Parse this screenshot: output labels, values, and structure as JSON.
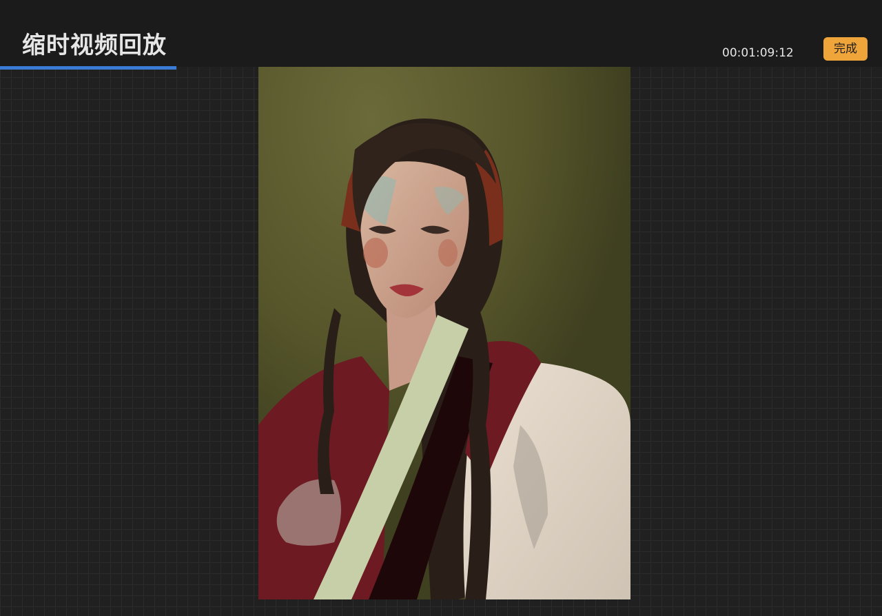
{
  "header": {
    "title": "缩时视频回放",
    "timecode": "00:01:09:12",
    "done_label": "完成"
  },
  "playback": {
    "progress_fraction": 0.2
  },
  "colors": {
    "accent_blue": "#3a7bd5",
    "done_button": "#f0a53a",
    "background": "#202020"
  },
  "canvas": {
    "content": "painting-portrait"
  }
}
